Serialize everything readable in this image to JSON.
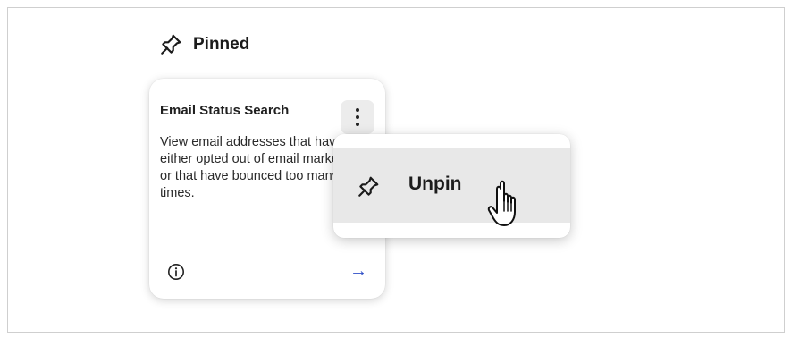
{
  "section": {
    "title": "Pinned",
    "icon": "pin-icon"
  },
  "card": {
    "title": "Email Status Search",
    "description": "View email addresses that have either opted out of email marketing or that have bounced too many times.",
    "menu_icon": "kebab-menu-icon",
    "info_icon": "info-icon",
    "open_arrow": "→"
  },
  "menu": {
    "items": [
      {
        "label": "Unpin",
        "icon": "pin-icon"
      }
    ]
  },
  "cursor": "hand-pointer-icon",
  "colors": {
    "accent": "#2f4fc7",
    "hover": "#e8e8e8",
    "border": "#cfcfcf"
  }
}
